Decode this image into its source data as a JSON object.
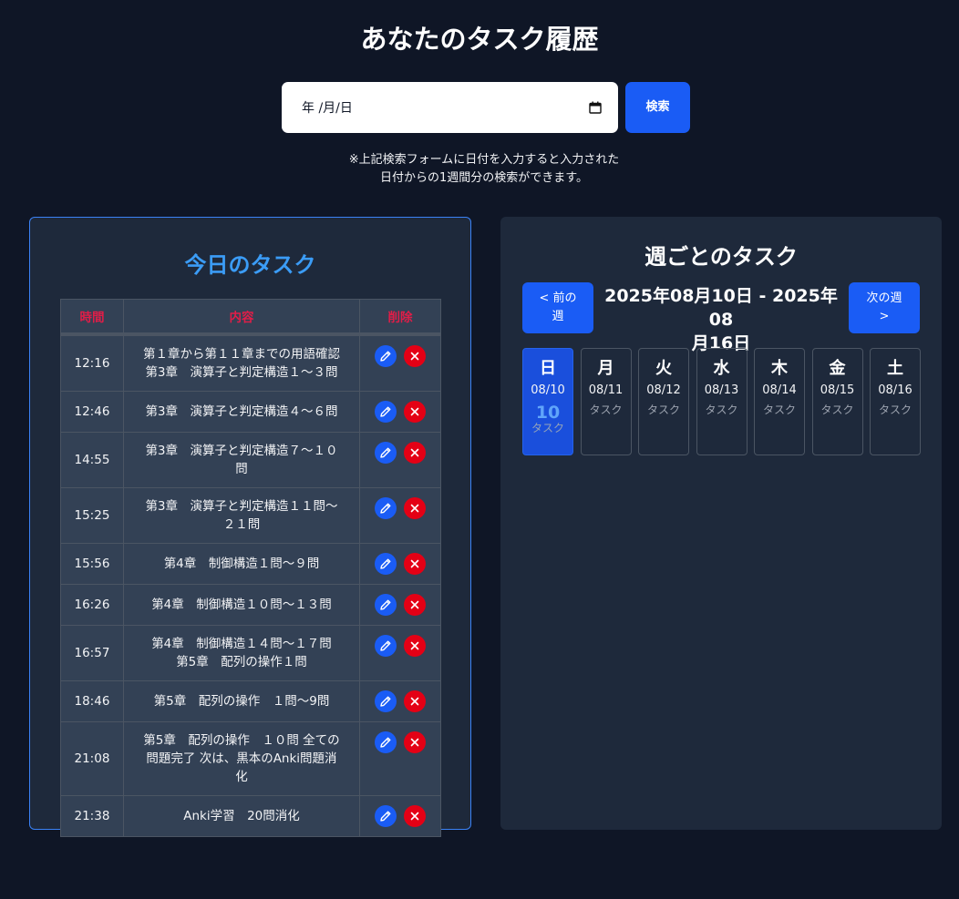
{
  "page": {
    "title": "あなたのタスク履歴"
  },
  "search": {
    "date_placeholder": "年 /月/日",
    "button_label": "検索",
    "note_line1": "※上記検索フォームに日付を入力すると入力された",
    "note_line2": "日付からの1週間分の検索ができます。"
  },
  "today": {
    "title": "今日のタスク",
    "columns": {
      "time": "時間",
      "content": "内容",
      "delete": "削除"
    },
    "rows": [
      {
        "time": "12:16",
        "content_lines": [
          "第１章から第１１章までの用語確認",
          "第3章　演算子と判定構造１～３問"
        ]
      },
      {
        "time": "12:46",
        "content_lines": [
          "第3章　演算子と判定構造４～６問"
        ]
      },
      {
        "time": "14:55",
        "content_lines": [
          "第3章　演算子と判定構造７～１０",
          "問"
        ]
      },
      {
        "time": "15:25",
        "content_lines": [
          "第3章　演算子と判定構造１１問～",
          "２１問"
        ]
      },
      {
        "time": "15:56",
        "content_lines": [
          "第4章　制御構造１問～９問"
        ]
      },
      {
        "time": "16:26",
        "content_lines": [
          "第4章　制御構造１０問～１３問"
        ]
      },
      {
        "time": "16:57",
        "content_lines": [
          "第4章　制御構造１４問～１７問",
          "第5章　配列の操作１問"
        ]
      },
      {
        "time": "18:46",
        "content_lines": [
          "第5章　配列の操作　１問～9問"
        ]
      },
      {
        "time": "21:08",
        "content_lines": [
          "第5章　配列の操作　１０問 全ての",
          "問題完了 次は、黒本のAnki問題消",
          "化"
        ]
      },
      {
        "time": "21:38",
        "content_lines": [
          "Anki学習　20問消化"
        ]
      }
    ]
  },
  "week": {
    "title": "週ごとのタスク",
    "prev_label_1": "< 前の",
    "prev_label_2": "週",
    "next_label_1": "次の週",
    "next_label_2": ">",
    "range_line1": "2025年08月10日 - 2025年08",
    "range_line2": "月16日",
    "days": [
      {
        "name": "日",
        "date": "08/10",
        "count": "10",
        "label": "タスク",
        "active": true
      },
      {
        "name": "月",
        "date": "08/11",
        "count": "",
        "label": "タスク",
        "active": false
      },
      {
        "name": "火",
        "date": "08/12",
        "count": "",
        "label": "タスク",
        "active": false
      },
      {
        "name": "水",
        "date": "08/13",
        "count": "",
        "label": "タスク",
        "active": false
      },
      {
        "name": "木",
        "date": "08/14",
        "count": "",
        "label": "タスク",
        "active": false
      },
      {
        "name": "金",
        "date": "08/15",
        "count": "",
        "label": "タスク",
        "active": false
      },
      {
        "name": "土",
        "date": "08/16",
        "count": "",
        "label": "タスク",
        "active": false
      }
    ]
  },
  "colors": {
    "background": "#0f1626",
    "panel": "#1e293b",
    "accent_blue": "#1a5cf5",
    "delete_red": "#e40015",
    "today_title": "#3b9cf6",
    "header_red": "#e11d48"
  },
  "icons": {
    "edit": "pencil-icon",
    "delete": "close-icon",
    "date": "calendar-icon"
  }
}
